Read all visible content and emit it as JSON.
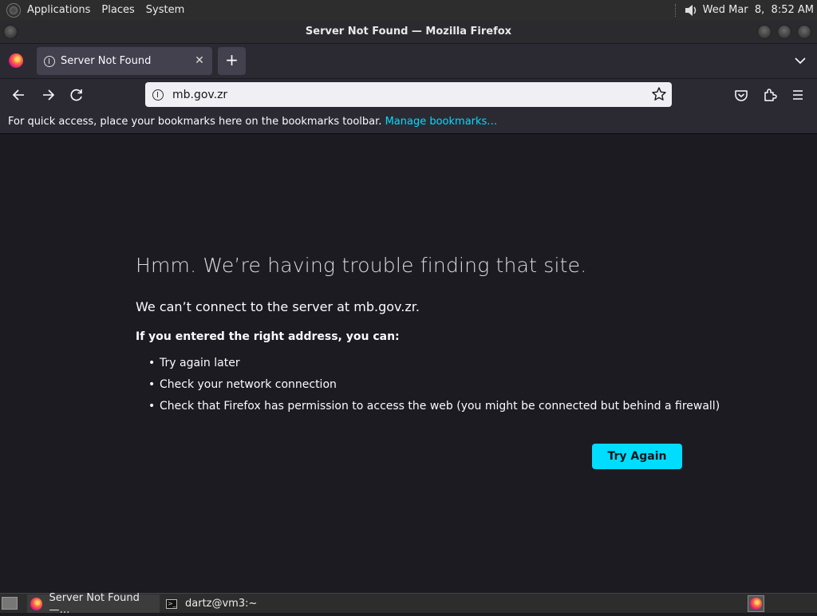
{
  "top_panel": {
    "menus": [
      "Applications",
      "Places",
      "System"
    ],
    "clock": "Wed Mar  8,  8:52 AM"
  },
  "window": {
    "title": "Server Not Found — Mozilla Firefox"
  },
  "tabs": [
    {
      "label": "Server Not Found",
      "active": true
    }
  ],
  "new_tab_label": "+",
  "url": "mb.gov.zr",
  "bookmarks_bar": {
    "message": "For quick access, place your bookmarks here on the bookmarks toolbar.",
    "link": "Manage bookmarks…"
  },
  "error_page": {
    "title": "Hmm. We’re having trouble finding that site.",
    "description": "We can’t connect to the server at mb.gov.zr.",
    "hint": "If you entered the right address, you can:",
    "suggestions": [
      "Try again later",
      "Check your network connection",
      "Check that Firefox has permission to access the web (you might be connected but behind a firewall)"
    ],
    "button": "Try Again"
  },
  "taskbar": {
    "items": [
      "Server Not Found —…",
      "dartz@vm3:~"
    ]
  },
  "colors": {
    "accent": "#00ddff",
    "content_bg": "#1c1b22",
    "toolbar_bg": "#2b2a33"
  }
}
